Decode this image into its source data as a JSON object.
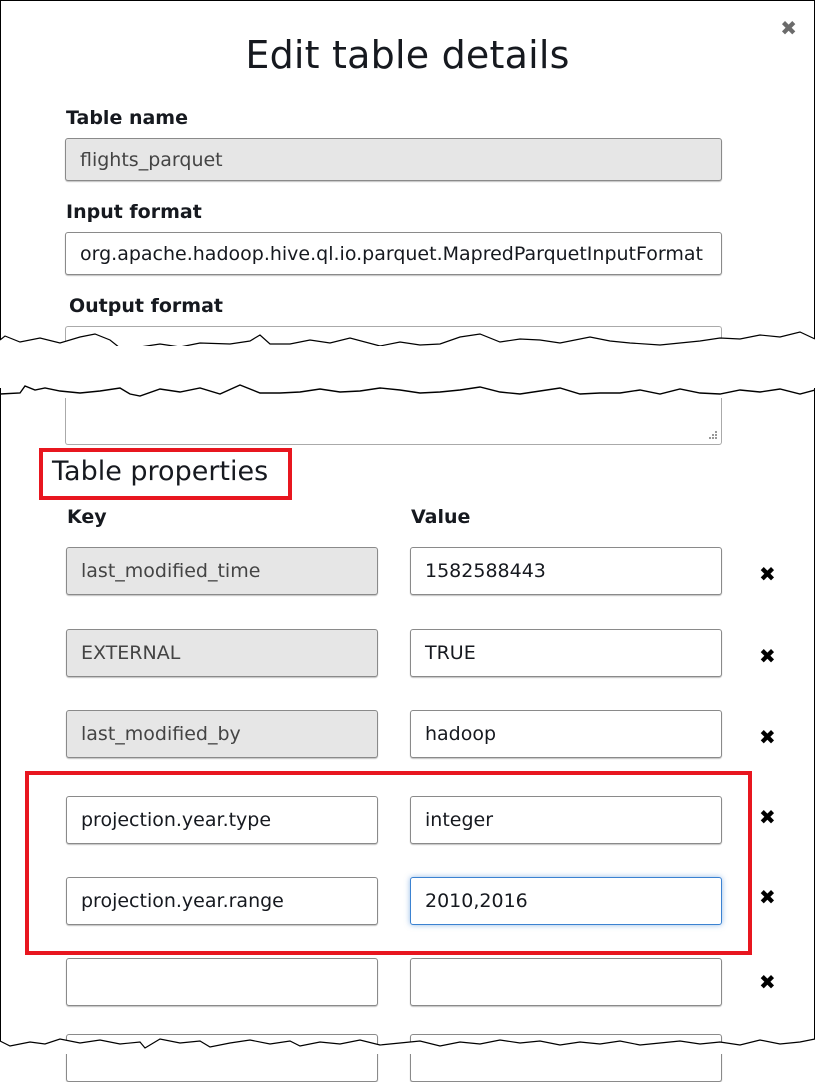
{
  "dialog": {
    "title": "Edit table details",
    "close_icon": "close-icon"
  },
  "table_name": {
    "label": "Table name",
    "value": "flights_parquet",
    "readonly": true
  },
  "input_format": {
    "label": "Input format",
    "value": "org.apache.hadoop.hive.ql.io.parquet.MapredParquetInputFormat"
  },
  "output_format": {
    "label": "Output format",
    "value": ""
  },
  "table_properties": {
    "heading": "Table properties",
    "key_header": "Key",
    "value_header": "Value",
    "rows": [
      {
        "key": "last_modified_time",
        "value": "1582588443",
        "key_readonly": true
      },
      {
        "key": "EXTERNAL",
        "value": "TRUE",
        "key_readonly": true
      },
      {
        "key": "last_modified_by",
        "value": "hadoop",
        "key_readonly": true
      },
      {
        "key": "projection.year.type",
        "value": "integer",
        "key_readonly": false
      },
      {
        "key": "projection.year.range",
        "value": "2010,2016",
        "key_readonly": false,
        "focused": true
      },
      {
        "key": "",
        "value": "",
        "key_readonly": false
      },
      {
        "key": "",
        "value": "",
        "key_readonly": false
      }
    ],
    "delete_icon": "delete-icon"
  },
  "highlight_color": "#e8161f",
  "focus_color": "#3b82d1"
}
